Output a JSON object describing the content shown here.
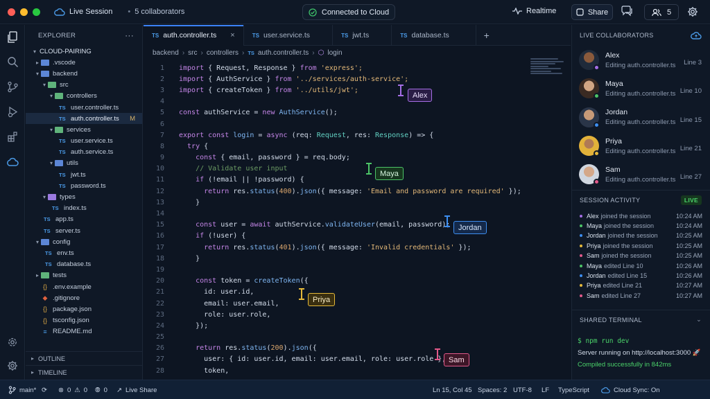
{
  "titlebar": {
    "session_label": "Live Session",
    "collaborators_label": "5 collaborators",
    "connection_status": "Connected to Cloud",
    "realtime_label": "Realtime",
    "share_label": "Share",
    "users_count": "5"
  },
  "explorer": {
    "title": "EXPLORER",
    "more": "···",
    "root": "CLOUD-PAIRING",
    "outline": "OUTLINE",
    "timeline": "TIMELINE",
    "items": [
      {
        "label": ".vscode"
      },
      {
        "label": "backend"
      },
      {
        "label": "src"
      },
      {
        "label": "controllers"
      },
      {
        "label": "user.controller.ts"
      },
      {
        "label": "auth.controller.ts",
        "flag": "M"
      },
      {
        "label": "services"
      },
      {
        "label": "user.service.ts"
      },
      {
        "label": "auth.service.ts"
      },
      {
        "label": "utils"
      },
      {
        "label": "jwt.ts"
      },
      {
        "label": "password.ts"
      },
      {
        "label": "types"
      },
      {
        "label": "index.ts"
      },
      {
        "label": "app.ts"
      },
      {
        "label": "server.ts"
      },
      {
        "label": "config"
      },
      {
        "label": "env.ts"
      },
      {
        "label": "database.ts"
      },
      {
        "label": "tests"
      },
      {
        "label": ".env.example"
      },
      {
        "label": ".gitignore"
      },
      {
        "label": "package.json"
      },
      {
        "label": "tsconfig.json"
      },
      {
        "label": "README.md"
      }
    ]
  },
  "tabs": [
    {
      "label": "auth.controller.ts",
      "close": "×"
    },
    {
      "label": "user.service.ts"
    },
    {
      "label": "jwt.ts"
    },
    {
      "label": "database.ts"
    }
  ],
  "tab_add": "+",
  "tab_badge": "TS",
  "breadcrumb": [
    "backend",
    "src",
    "controllers",
    "auth.controller.ts",
    "login"
  ],
  "code_lines": [
    "1",
    "2",
    "3",
    "4",
    "5",
    "6",
    "7",
    "8",
    "9",
    "10",
    "11",
    "12",
    "13",
    "14",
    "15",
    "16",
    "17",
    "18",
    "19",
    "20",
    "21",
    "22",
    "23",
    "24",
    "25",
    "26",
    "27",
    "28"
  ],
  "code": {
    "l1": [
      "import",
      " { Request, Response } ",
      "from",
      " 'express';"
    ],
    "l2": [
      "import",
      " { AuthService } ",
      "from",
      " '../services/auth-service';"
    ],
    "l3": [
      "import",
      " { createToken } ",
      "from",
      " '../utils/jwt';"
    ],
    "l5": [
      "const",
      " authService = ",
      "new",
      " AuthService",
      "();"
    ],
    "l7": [
      "export const",
      " login",
      " = ",
      "async",
      " (req: ",
      "Request",
      ", res: ",
      "Response",
      ") => {"
    ],
    "l8": [
      "  try",
      " {"
    ],
    "l9": [
      "    const",
      " { email, password } = req.body;"
    ],
    "l10": [
      "    // Validate user input"
    ],
    "l11": [
      "    if",
      " (!email || !password) {"
    ],
    "l12": [
      "      return",
      " res.",
      "status",
      "(",
      "400",
      ").",
      "json",
      "({ message: ",
      "'Email and password are required'",
      " });"
    ],
    "l13": [
      "    }"
    ],
    "l15": [
      "    const",
      " user = ",
      "await",
      " authService.",
      "validateUser",
      "(email, password);"
    ],
    "l16": [
      "    if",
      " (!user) {"
    ],
    "l17": [
      "      return",
      " res.",
      "status",
      "(",
      "401",
      ").",
      "json",
      "({ message: ",
      "'Invalid credentials'",
      " });"
    ],
    "l18": [
      "    }"
    ],
    "l20": [
      "    const",
      " token = ",
      "createToken",
      "({"
    ],
    "l21": [
      "      id: user.id,"
    ],
    "l22": [
      "      email: user.email,"
    ],
    "l23": [
      "      role: user.role,"
    ],
    "l24": [
      "    });"
    ],
    "l26": [
      "    return",
      " res.",
      "status",
      "(",
      "200",
      ").",
      "json",
      "({"
    ],
    "l27": [
      "      user: { id: user.id, email: user.email, role: user.role },"
    ],
    "l28": [
      "      token,"
    ]
  },
  "cursors": [
    {
      "name": "Alex",
      "color": "#a56ee6",
      "bg": "#2a1d45"
    },
    {
      "name": "Maya",
      "color": "#4cc467",
      "bg": "#17351f"
    },
    {
      "name": "Jordan",
      "color": "#3d8ef0",
      "bg": "#14294a"
    },
    {
      "name": "Priya",
      "color": "#e5b93a",
      "bg": "#3a2f10"
    },
    {
      "name": "Sam",
      "color": "#e2598a",
      "bg": "#3d1627"
    }
  ],
  "right_panel": {
    "title": "LIVE COLLABORATORS",
    "collaborators": [
      {
        "name": "Alex",
        "status": "Editing auth.controller.ts",
        "line": "Line 3",
        "color": "#a56ee6",
        "skin": "#8a5a3c"
      },
      {
        "name": "Maya",
        "status": "Editing auth.controller.ts",
        "line": "Line 10",
        "color": "#4cc467",
        "skin": "#d1a583"
      },
      {
        "name": "Jordan",
        "status": "Editing auth.controller.ts",
        "line": "Line 15",
        "color": "#3d8ef0",
        "skin": "#c79a78"
      },
      {
        "name": "Priya",
        "status": "Editing auth.controller.ts",
        "line": "Line 21",
        "color": "#e5b93a",
        "skin": "#b07a55"
      },
      {
        "name": "Sam",
        "status": "Editing auth.controller.ts",
        "line": "Line 27",
        "color": "#e2598a",
        "skin": "#d4a889"
      }
    ],
    "activity_title": "SESSION ACTIVITY",
    "live_badge": "LIVE",
    "activity": [
      {
        "who": "Alex",
        "what": "joined the session",
        "time": "10:24 AM",
        "color": "#a56ee6"
      },
      {
        "who": "Maya",
        "what": "joined the session",
        "time": "10:24 AM",
        "color": "#4cc467"
      },
      {
        "who": "Jordan",
        "what": "joined the session",
        "time": "10:25 AM",
        "color": "#3d8ef0"
      },
      {
        "who": "Priya",
        "what": "joined the session",
        "time": "10:25 AM",
        "color": "#e5b93a"
      },
      {
        "who": "Sam",
        "what": "joined the session",
        "time": "10:25 AM",
        "color": "#e2598a"
      },
      {
        "who": "Maya",
        "what": "edited Line 10",
        "time": "10:26 AM",
        "color": "#4cc467"
      },
      {
        "who": "Jordan",
        "what": "edited Line 15",
        "time": "10:26 AM",
        "color": "#3d8ef0"
      },
      {
        "who": "Priya",
        "what": "edited Line 21",
        "time": "10:27 AM",
        "color": "#e5b93a"
      },
      {
        "who": "Sam",
        "what": "edited Line 27",
        "time": "10:27 AM",
        "color": "#e2598a"
      }
    ],
    "terminal_title": "SHARED TERMINAL",
    "terminal": {
      "cmd": "$ npm run dev",
      "line1": "Server running on http://localhost:3000 🚀",
      "line2": "Compiled successfully in 842ms"
    }
  },
  "statusbar": {
    "branch": "main*",
    "errors": "0",
    "warnings": "0",
    "ports": "0",
    "live_share": "Live Share",
    "position": "Ln 15, Col 45",
    "spaces": "Spaces: 2",
    "encoding": "UTF-8",
    "eol": "LF",
    "language": "TypeScript",
    "cloud_sync": "Cloud Sync: On"
  }
}
